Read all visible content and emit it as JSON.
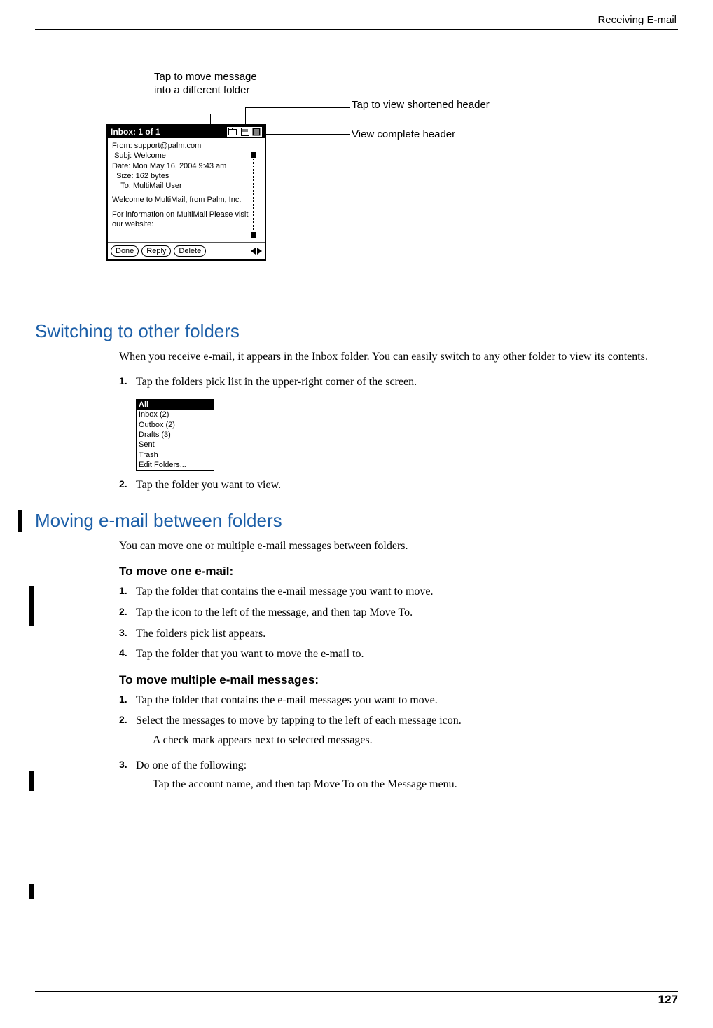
{
  "header": {
    "chapter": "Receiving E-mail"
  },
  "footer": {
    "page_number": "127"
  },
  "figure": {
    "callouts": {
      "move_folder": "Tap to move message into a different folder",
      "short_header": "Tap to view shortened header",
      "full_header": "View complete header"
    },
    "titlebar": "Inbox:  1 of 1",
    "headers": {
      "from_label": "From:",
      "from": "support@palm.com",
      "subj_label": "Subj:",
      "subj": "Welcome",
      "date_label": "Date:",
      "date": "Mon May 16, 2004 9:43 am",
      "size_label": "Size:",
      "size": "162 bytes",
      "to_label": "To:",
      "to": "MultiMail User"
    },
    "body_line1": "Welcome to MultiMail, from Palm, Inc.",
    "body_line2": "For information on MultiMail Please visit our website:",
    "buttons": {
      "done": "Done",
      "reply": "Reply",
      "delete": "Delete"
    }
  },
  "section1": {
    "title": "Switching to other folders",
    "intro": "When you receive e-mail, it appears in the Inbox folder. You can easily switch to any other folder to view its contents.",
    "step1": "Tap the folders pick list in the upper-right corner of the screen.",
    "dropdown": {
      "header": "All",
      "items": [
        "Inbox (2)",
        "Outbox (2)",
        "Drafts (3)",
        "Sent",
        "Trash",
        "Edit Folders..."
      ]
    },
    "step2": "Tap the folder you want to view."
  },
  "section2": {
    "title": "Moving e-mail between folders",
    "intro": "You can move one or multiple e-mail messages between folders.",
    "sub1_title": "To move one e-mail:",
    "sub1_steps": [
      "Tap the folder that contains the e-mail message you want to move.",
      "Tap the icon to the left of the message, and then tap Move To.",
      "The folders pick list appears.",
      "Tap the folder that you want to move the e-mail to."
    ],
    "sub2_title": "To move multiple e-mail messages:",
    "sub2_steps": [
      "Tap the folder that contains the e-mail messages you want to move.",
      "Select the messages to move by tapping to the left of each message icon."
    ],
    "sub2_note": "A check mark appears next to selected messages.",
    "sub2_step3": "Do one of the following:",
    "sub2_action": "Tap the account name, and then tap Move To on the Message menu."
  }
}
